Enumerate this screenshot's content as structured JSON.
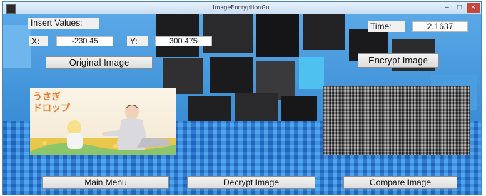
{
  "window": {
    "title": "ImageEncryptionGui",
    "min_glyph": "–",
    "max_glyph": "□",
    "close_glyph": "×"
  },
  "labels": {
    "insert_values": "Insert Values:",
    "x": "X:",
    "y": "Y:",
    "time": "Time:"
  },
  "values": {
    "x": "-230.45",
    "y": "300.475",
    "time": "2.1637"
  },
  "buttons": {
    "original_image": "Original Image",
    "encrypt_image": "Encrypt Image",
    "main_menu": "Main Menu",
    "decrypt_image": "Decrypt Image",
    "compare_image": "Compare Image"
  },
  "original_image": {
    "title_line1": "うさぎ",
    "title_line2": "ドロップ"
  }
}
